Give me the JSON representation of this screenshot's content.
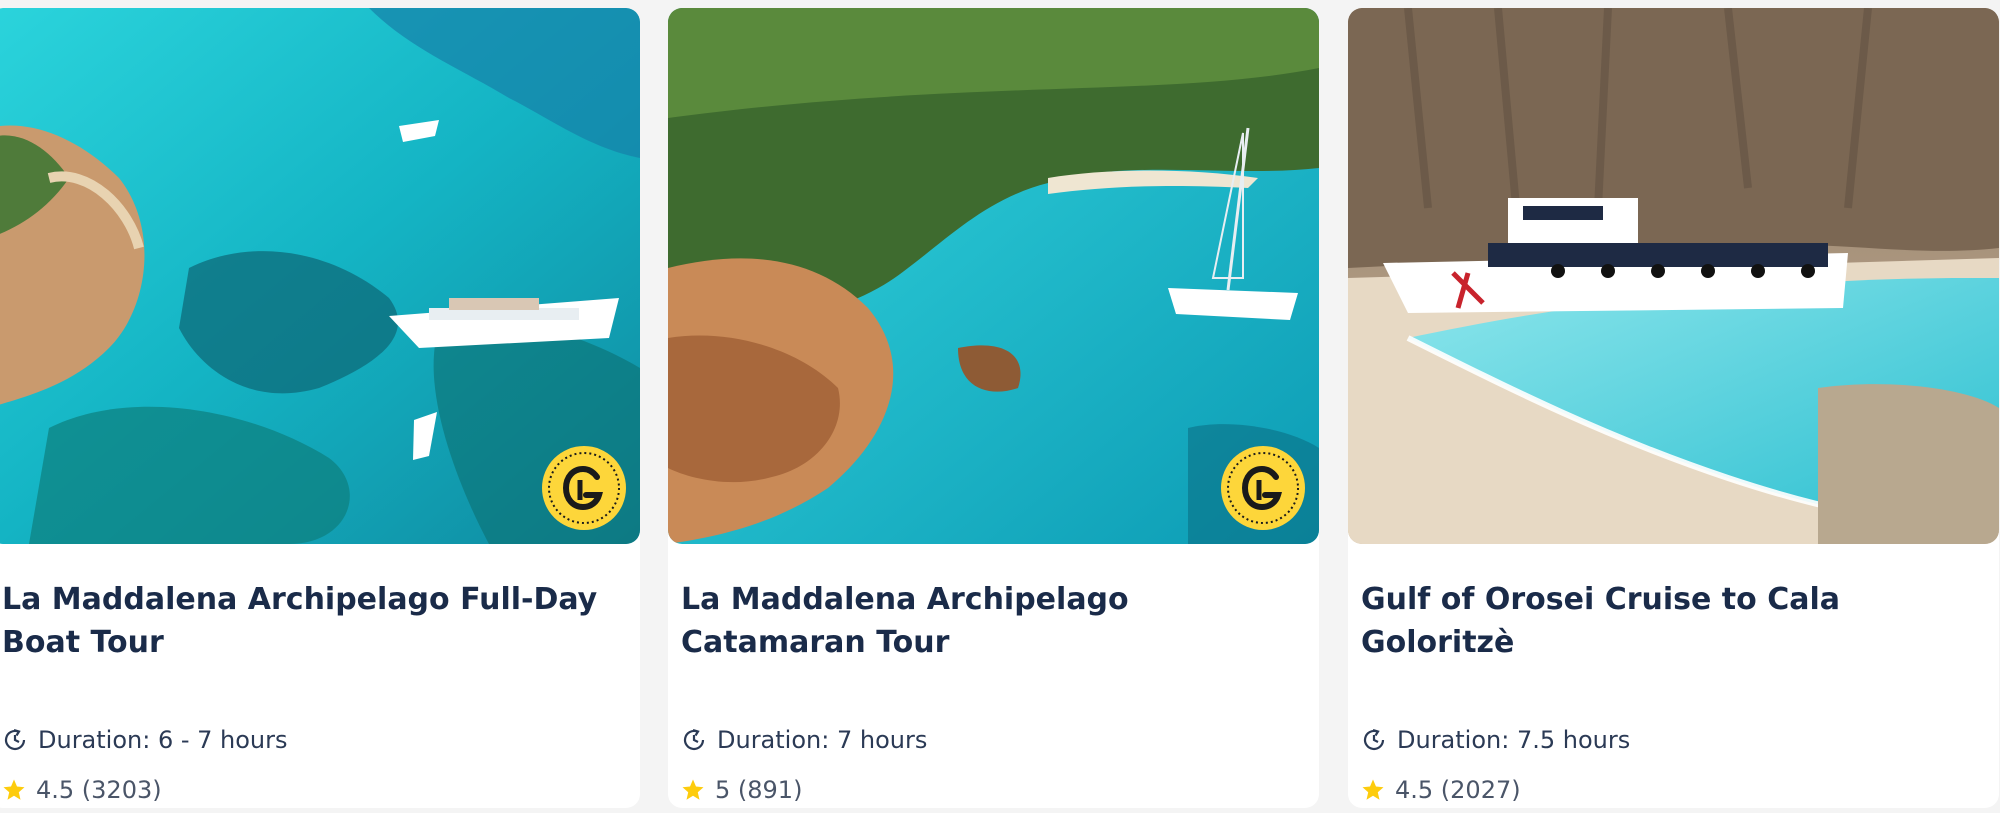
{
  "cards": [
    {
      "title": "La Maddalena Archipelago Full-Day Boat Tour",
      "duration": "Duration: 6 - 7 hours",
      "rating": "4.5 (3203)",
      "has_badge": true,
      "badge_icon": "getyourguide-original-badge-icon"
    },
    {
      "title": "La Maddalena Archipelago Catamaran Tour",
      "duration": "Duration: 7 hours",
      "rating": "5 (891)",
      "has_badge": true,
      "badge_icon": "getyourguide-original-badge-icon"
    },
    {
      "title": "Gulf of Orosei Cruise to Cala Goloritzè",
      "duration": "Duration: 7.5 hours",
      "rating": "4.5 (2027)",
      "has_badge": false
    }
  ],
  "colors": {
    "title": "#1a2b49",
    "star": "#fdcc0d",
    "badge": "#fdd63a",
    "sea": "#1fc7d1",
    "card_bg": "#ffffff",
    "page_bg": "#f4f4f4"
  }
}
